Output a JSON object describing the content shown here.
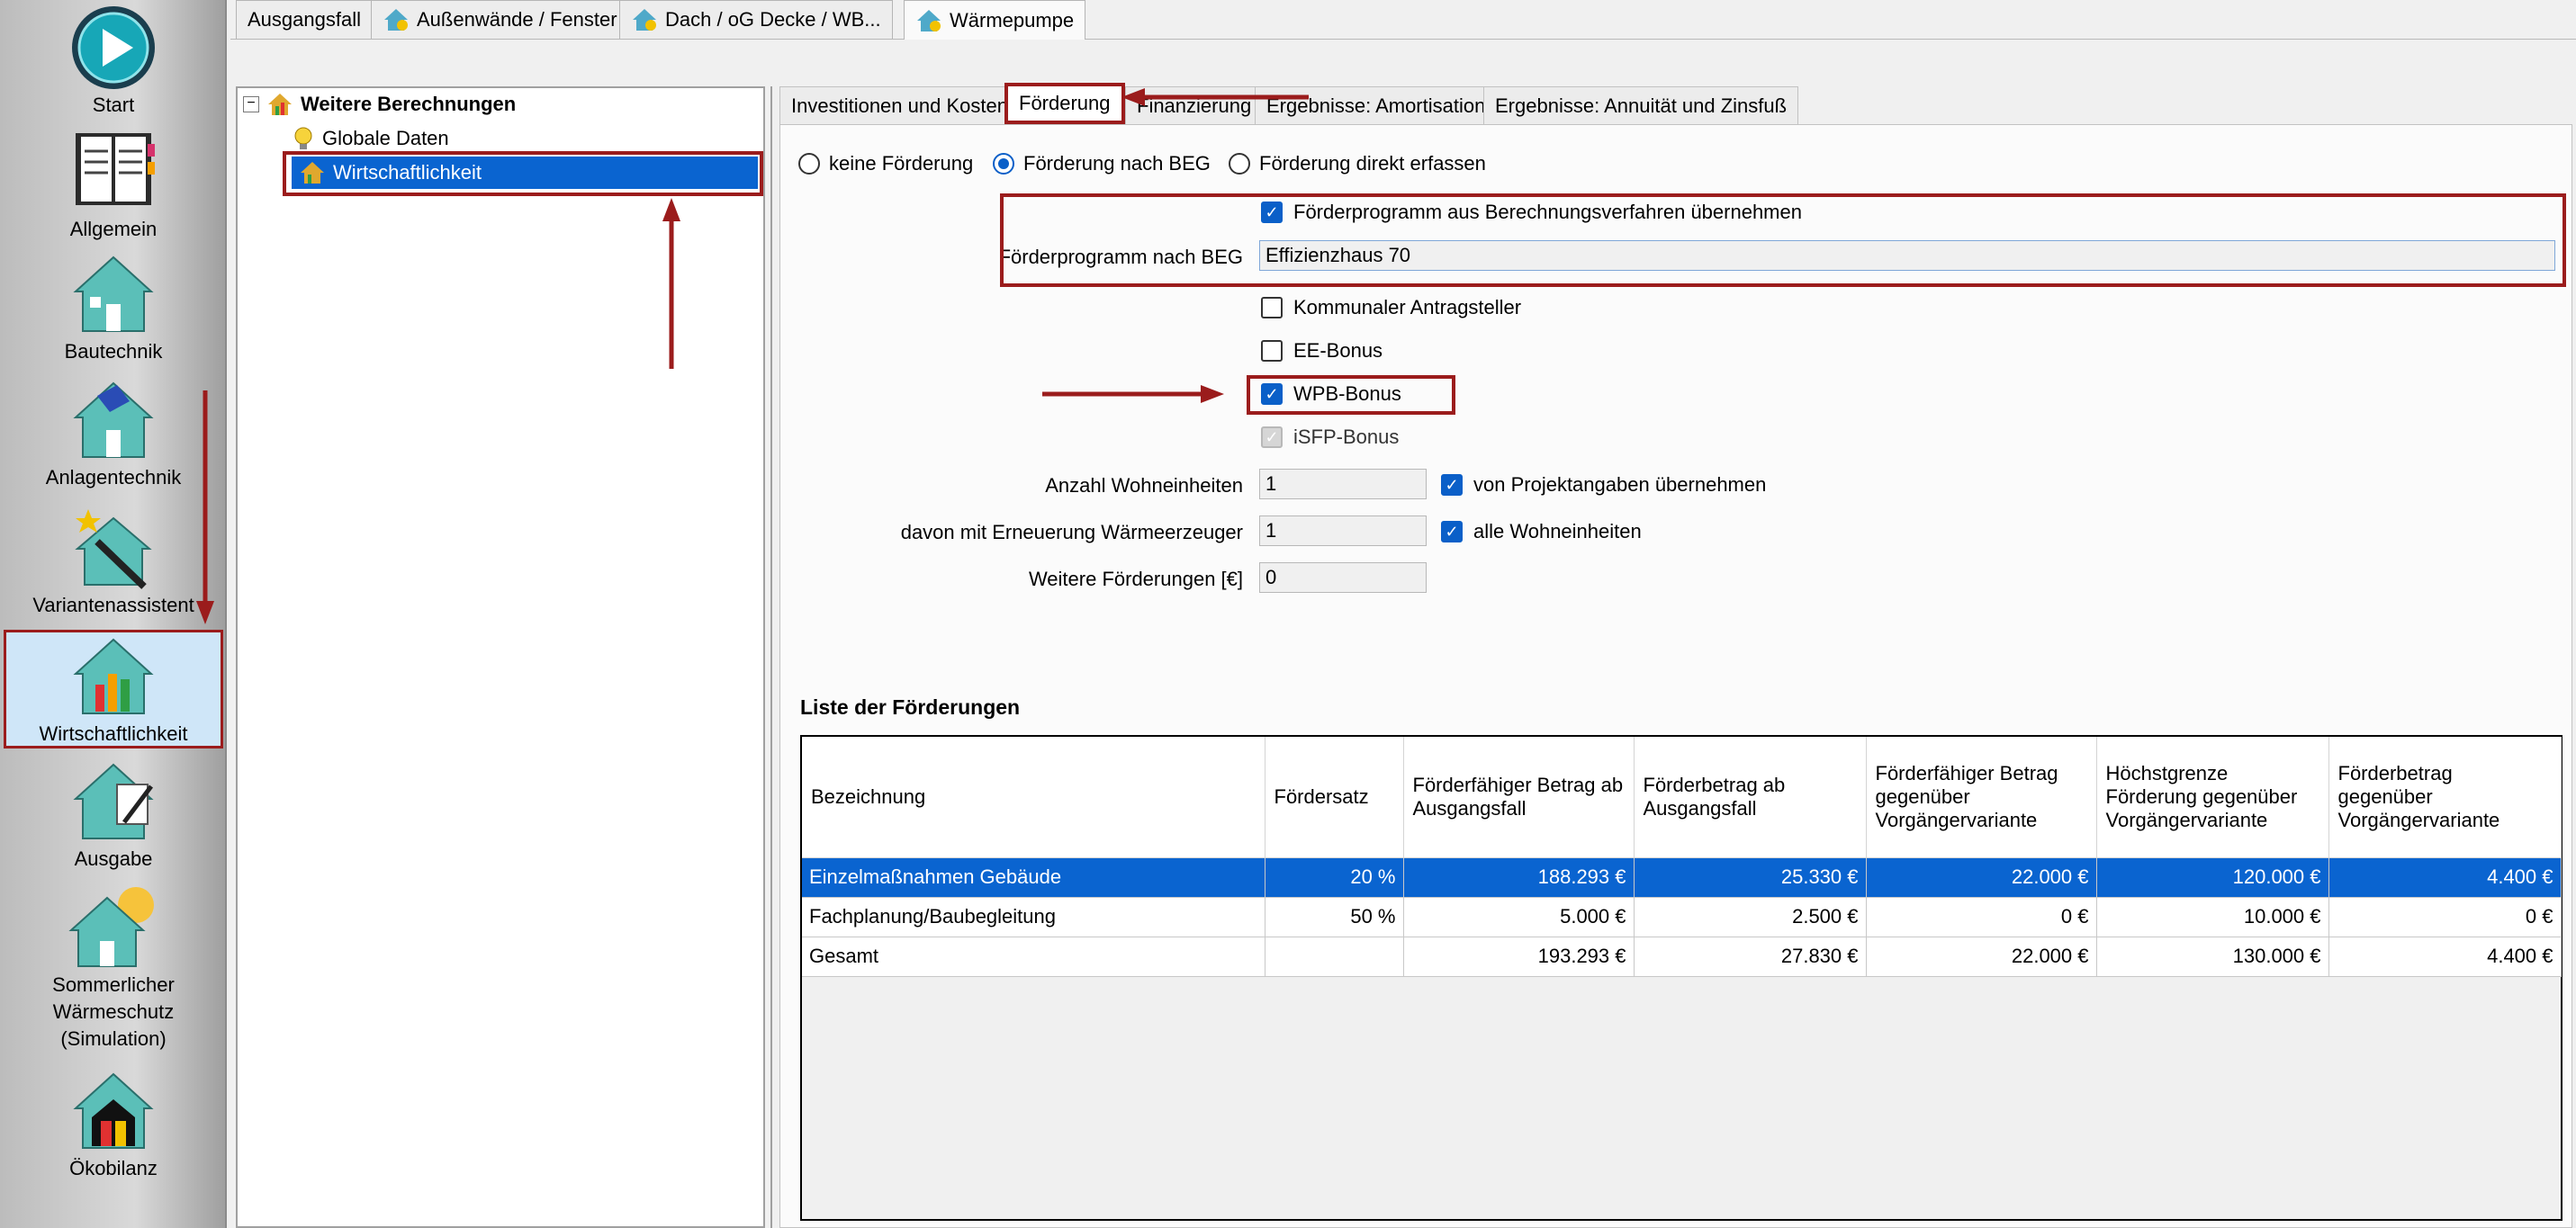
{
  "nav": {
    "items": [
      {
        "key": "start",
        "label": "Start"
      },
      {
        "key": "allgemein",
        "label": "Allgemein"
      },
      {
        "key": "bautechnik",
        "label": "Bautechnik"
      },
      {
        "key": "anlagentechnik",
        "label": "Anlagentechnik"
      },
      {
        "key": "variantenassistent",
        "label": "Variantenassistent"
      },
      {
        "key": "wirtschaftlichkeit",
        "label": "Wirtschaftlichkeit"
      },
      {
        "key": "ausgabe",
        "label": "Ausgabe"
      },
      {
        "key": "sommerlicher",
        "label": "Sommerlicher\nWärmeschutz\n(Simulation)"
      },
      {
        "key": "oekobilanz",
        "label": "Ökobilanz"
      }
    ],
    "active": "wirtschaftlichkeit"
  },
  "top_tabs": [
    "Ausgangsfall",
    "Außenwände / Fenster",
    "Dach / oG Decke / WB...",
    "Wärmepumpe"
  ],
  "tree": {
    "root": "Weitere Berechnungen",
    "children": [
      "Globale Daten",
      "Wirtschaftlichkeit"
    ],
    "selected": "Wirtschaftlichkeit",
    "expander": "−"
  },
  "inner_tabs": [
    "Investitionen und Kosten",
    "Förderung",
    "Finanzierung",
    "Ergebnisse: Amortisation",
    "Ergebnisse: Annuität und Zinsfuß"
  ],
  "inner_tab_active": "Förderung",
  "radios": {
    "options": [
      "keine Förderung",
      "Förderung nach BEG",
      "Förderung direkt erfassen"
    ],
    "selected": "Förderung nach BEG"
  },
  "foerderung": {
    "uebernehmen_label": "Förderprogramm aus Berechnungsverfahren übernehmen",
    "uebernehmen_checked": true,
    "programm_label": "Förderprogramm nach BEG",
    "programm_value": "Effizienzhaus 70",
    "kommunal_label": "Kommunaler Antragsteller",
    "kommunal_checked": false,
    "ee_label": "EE-Bonus",
    "ee_checked": false,
    "wpb_label": "WPB-Bonus",
    "wpb_checked": true,
    "isfp_label": "iSFP-Bonus",
    "isfp_checked": true,
    "isfp_disabled": true,
    "wohneinheiten_label": "Anzahl Wohneinheiten",
    "wohneinheiten_value": "1",
    "projekt_label": "von Projektangaben übernehmen",
    "projekt_checked": true,
    "erneuerung_label": "davon mit Erneuerung Wärmeerzeuger",
    "erneuerung_value": "1",
    "alle_label": "alle Wohneinheiten",
    "alle_checked": true,
    "weitere_label": "Weitere Förderungen [€]",
    "weitere_value": "0"
  },
  "liste": {
    "title": "Liste der Förderungen",
    "headers": [
      "Bezeichnung",
      "Fördersatz",
      "Förderfähiger Betrag ab Ausgangsfall",
      "Förderbetrag ab Ausgangsfall",
      "Förderfähiger Betrag gegenüber Vorgängervariante",
      "Höchstgrenze Förderung gegenüber Vorgängervariante",
      "Förderbetrag gegenüber Vorgängervariante"
    ],
    "rows": [
      [
        "Einzelmaßnahmen Gebäude",
        "20 %",
        "188.293 €",
        "25.330 €",
        "22.000 €",
        "120.000 €",
        "4.400 €"
      ],
      [
        "Fachplanung/Baubegleitung",
        "50 %",
        "5.000 €",
        "2.500 €",
        "0 €",
        "10.000 €",
        "0 €"
      ],
      [
        "Gesamt",
        "",
        "193.293 €",
        "27.830 €",
        "22.000 €",
        "130.000 €",
        "4.400 €"
      ]
    ],
    "selected_row": 0
  },
  "icons": {
    "start": "play-icon",
    "allgemein": "notebook-icon",
    "bautechnik": "house-icon",
    "anlagentechnik": "house-solar-icon",
    "variantenassistent": "magic-wand-house-icon",
    "wirtschaftlichkeit": "house-chart-icon",
    "ausgabe": "house-pen-icon",
    "sommerlicher": "house-sun-icon",
    "oekobilanz": "house-eco-icon",
    "tab": "house-gear-icon"
  },
  "colors": {
    "accent": "#0a64d0",
    "highlight": "#9b1c1c",
    "nav_active": "#cfe6f8"
  }
}
